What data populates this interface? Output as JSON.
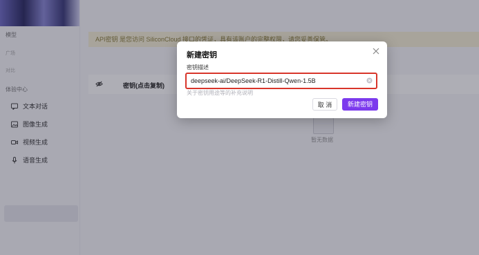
{
  "sidebar": {
    "section_model": "模型",
    "dim_item_1": "广场",
    "dim_item_2": "对比",
    "section_experience": "体验中心",
    "items": [
      {
        "label": "文本对话",
        "icon": "chat-icon"
      },
      {
        "label": "图像生成",
        "icon": "image-icon"
      },
      {
        "label": "视频生成",
        "icon": "video-icon"
      },
      {
        "label": "语音生成",
        "icon": "microphone-icon"
      }
    ]
  },
  "main": {
    "notice": "API密钥 是您访问 SiliconCloud 接口的凭证，具有该账户的完整权限，请您妥善保管。",
    "table": {
      "column_key": "密钥(点击复制)"
    },
    "empty_text": "暂无数据"
  },
  "modal": {
    "title": "新建密钥",
    "field_label": "密钥描述",
    "field_value": "deepseek-ai/DeepSeek-R1-Distill-Qwen-1.5B",
    "hint": "关于密钥用途等的补充说明",
    "cancel_label": "取 消",
    "create_label": "新建密钥"
  },
  "colors": {
    "accent": "#7c3aed",
    "highlight_border": "#d8352a",
    "notice_bg": "#f6f0d6"
  }
}
